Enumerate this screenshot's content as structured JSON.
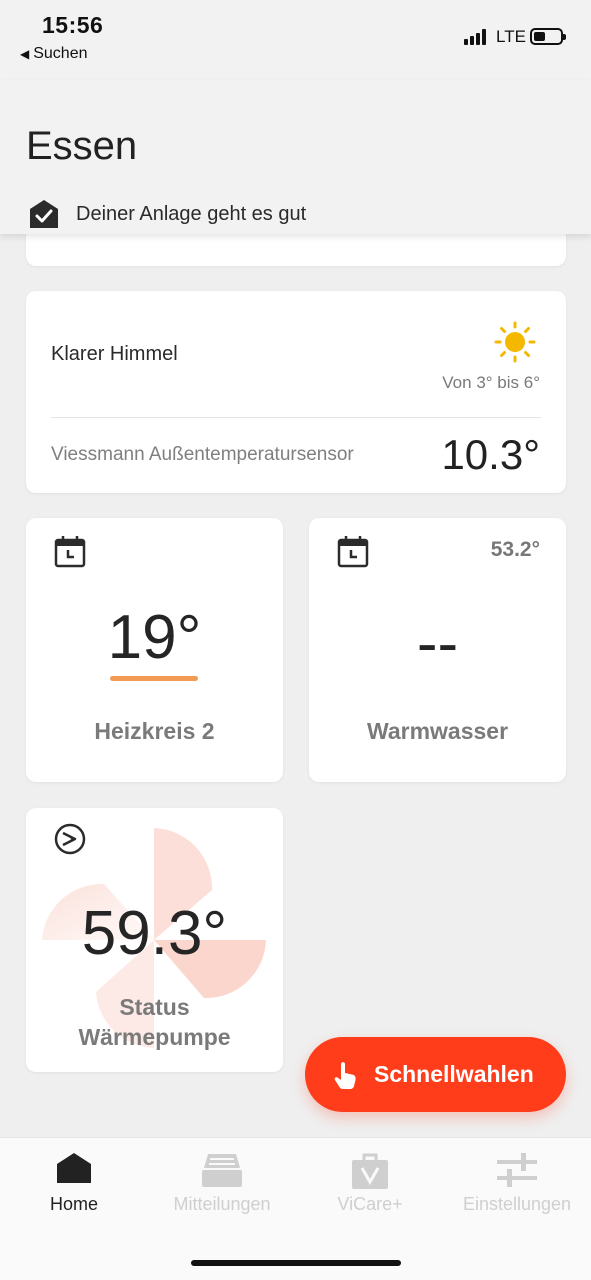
{
  "status_bar": {
    "time": "15:56",
    "back_label": "Suchen",
    "network": "LTE"
  },
  "header": {
    "title": "Essen",
    "health_text": "Deiner Anlage geht es gut"
  },
  "weather": {
    "condition": "Klarer Himmel",
    "range": "Von 3° bis 6°",
    "sensor_label": "Viessmann Außentemperatursensor",
    "sensor_value": "10.3°",
    "icon": "sun-icon"
  },
  "tiles": {
    "heizkreis": {
      "value": "19°",
      "label": "Heizkreis 2",
      "icon": "calendar-clock-icon",
      "accent": "#f29b55"
    },
    "warmwasser": {
      "value": "--",
      "label": "Warmwasser",
      "corner": "53.2°",
      "icon": "calendar-clock-icon"
    },
    "heatpump": {
      "value": "59.3°",
      "label_line1": "Status",
      "label_line2": "Wärmepumpe",
      "icon": "heatpump-icon"
    }
  },
  "fab": {
    "label": "Schnellwahlen",
    "color": "#ff3d1a",
    "icon": "tap-hand-icon"
  },
  "tabbar": {
    "items": [
      {
        "label": "Home",
        "icon": "home-icon",
        "active": true
      },
      {
        "label": "Mitteilungen",
        "icon": "inbox-icon",
        "active": false
      },
      {
        "label": "ViCare+",
        "icon": "bag-icon",
        "active": false
      },
      {
        "label": "Einstellungen",
        "icon": "sliders-icon",
        "active": false
      }
    ]
  }
}
